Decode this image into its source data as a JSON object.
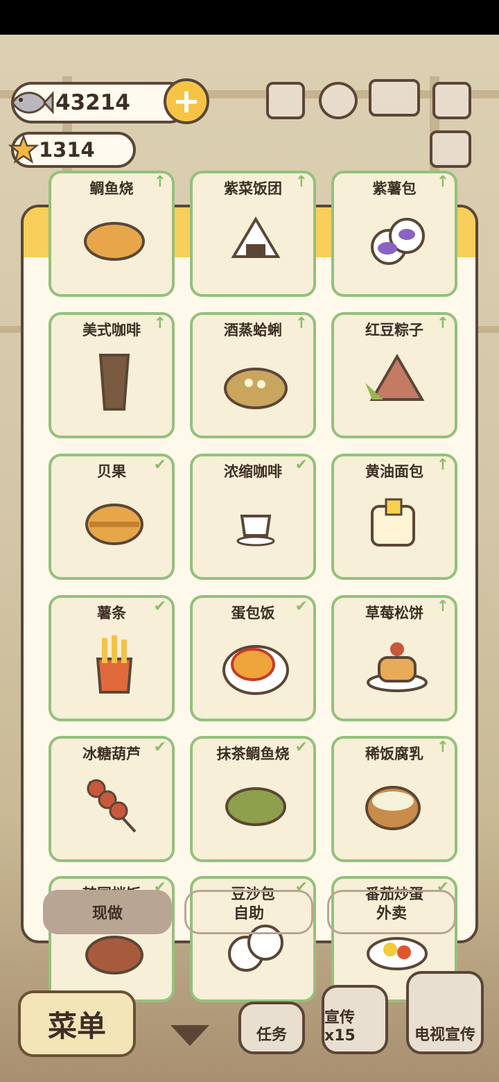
{
  "currency": {
    "fish": "43214",
    "stars": "1314"
  },
  "menu_items": [
    {
      "name": "鲷鱼烧",
      "status": "arrow"
    },
    {
      "name": "紫菜饭团",
      "status": "arrow"
    },
    {
      "name": "紫薯包",
      "status": "arrow"
    },
    {
      "name": "美式咖啡",
      "status": "arrow"
    },
    {
      "name": "酒蒸蛤蜊",
      "status": "arrow"
    },
    {
      "name": "红豆粽子",
      "status": "arrow"
    },
    {
      "name": "贝果",
      "status": "check"
    },
    {
      "name": "浓缩咖啡",
      "status": "check"
    },
    {
      "name": "黄油面包",
      "status": "arrow"
    },
    {
      "name": "薯条",
      "status": "check"
    },
    {
      "name": "蛋包饭",
      "status": "check"
    },
    {
      "name": "草莓松饼",
      "status": "arrow"
    },
    {
      "name": "冰糖葫芦",
      "status": "check"
    },
    {
      "name": "抹茶鲷鱼烧",
      "status": "check"
    },
    {
      "name": "稀饭腐乳",
      "status": "arrow"
    },
    {
      "name": "韩国拌饭",
      "status": "check"
    },
    {
      "name": "豆沙包",
      "status": "check"
    },
    {
      "name": "番茄炒蛋",
      "status": "check"
    }
  ],
  "tabs": {
    "now": "现做",
    "self": "自助",
    "takeout": "外卖"
  },
  "bottom": {
    "menu": "菜单",
    "tasks": "任务",
    "promo": "宣传x15",
    "tv": "电视宣传"
  },
  "marks": {
    "arrow": "↑",
    "check": "✔"
  }
}
